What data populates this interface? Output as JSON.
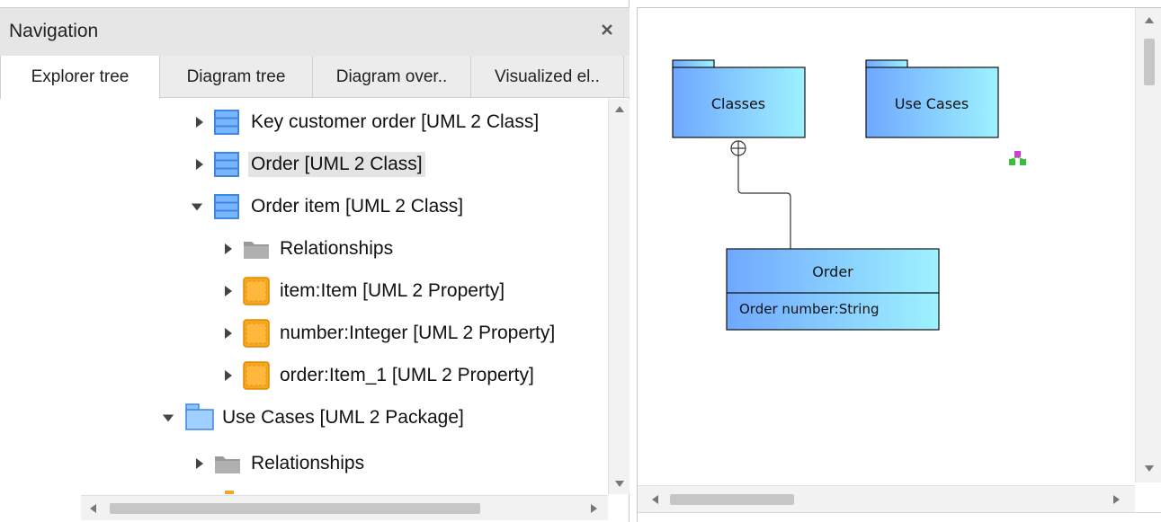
{
  "navigation": {
    "title": "Navigation",
    "close_icon": "close-icon",
    "tabs": [
      {
        "label": "Explorer tree",
        "active": true
      },
      {
        "label": "Diagram tree",
        "active": false
      },
      {
        "label": "Diagram over..",
        "active": false
      },
      {
        "label": "Visualized el..",
        "active": false
      }
    ],
    "tree": [
      {
        "label": "Key customer order [UML 2 Class]",
        "icon": "uml-class-icon",
        "expanded": false,
        "selected": false
      },
      {
        "label": "Order [UML 2 Class]",
        "icon": "uml-class-icon",
        "expanded": false,
        "selected": true
      },
      {
        "label": "Order item [UML 2 Class]",
        "icon": "uml-class-icon",
        "expanded": true,
        "selected": false
      },
      {
        "label": "Relationships",
        "icon": "folder-icon",
        "expanded": false,
        "selected": false
      },
      {
        "label": "item:Item [UML 2 Property]",
        "icon": "uml-property-icon",
        "expanded": false,
        "selected": false
      },
      {
        "label": "number:Integer [UML 2 Property]",
        "icon": "uml-property-icon",
        "expanded": false,
        "selected": false
      },
      {
        "label": "order:Item_1 [UML 2 Property]",
        "icon": "uml-property-icon",
        "expanded": false,
        "selected": false
      },
      {
        "label": "Use Cases [UML 2 Package]",
        "icon": "uml-package-icon",
        "expanded": true,
        "selected": false
      },
      {
        "label": "Relationships",
        "icon": "folder-icon",
        "expanded": false,
        "selected": false
      }
    ]
  },
  "diagram": {
    "packages": [
      {
        "name": "Classes"
      },
      {
        "name": "Use Cases"
      }
    ],
    "class": {
      "name": "Order",
      "attributes": [
        "Order number:String"
      ]
    },
    "connector_icon": "containment-circle-icon",
    "marker_icon": "hierarchy-icon",
    "colors": {
      "uml_gradient_start": "#6fa8ff",
      "uml_gradient_end": "#9ef2ff",
      "property_icon": "#f5a623",
      "folder_icon": "#9a9a9a",
      "selection": "#e4e4e4"
    }
  }
}
